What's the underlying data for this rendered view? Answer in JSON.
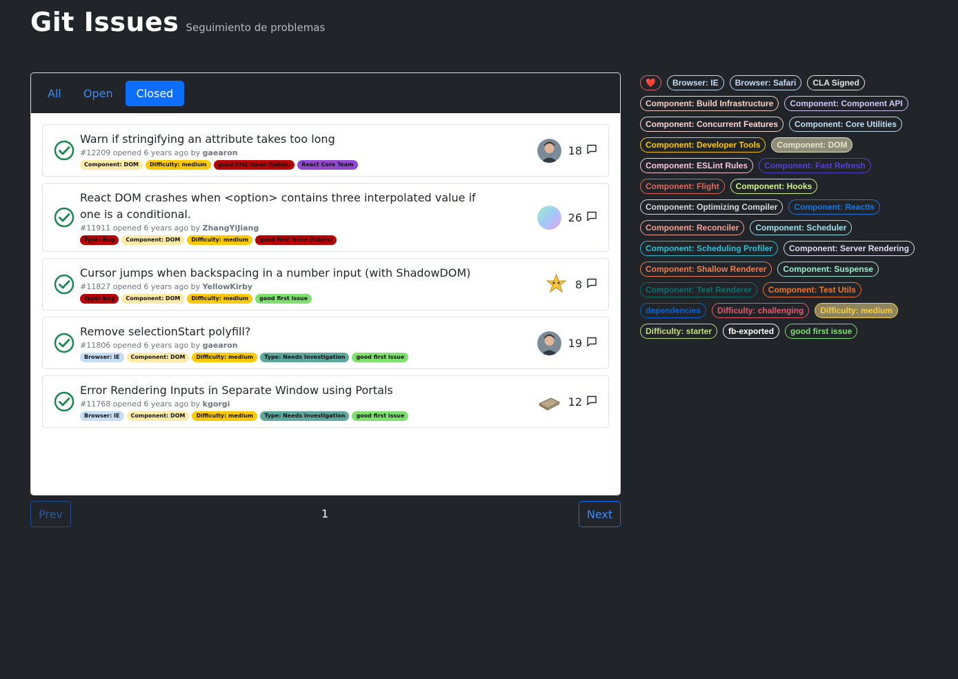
{
  "header": {
    "title": "Git Issues",
    "subtitle": "Seguimiento de problemas"
  },
  "tabs": [
    {
      "label": "All",
      "active": false
    },
    {
      "label": "Open",
      "active": false
    },
    {
      "label": "Closed",
      "active": true
    }
  ],
  "issues": [
    {
      "title": "Warn if stringifying an attribute takes too long",
      "number": "#12209",
      "opened": "opened 6 years ago by",
      "author": "gaearon",
      "comments": "18",
      "avatar": "person-avatar",
      "labels": [
        {
          "text": "Component: DOM",
          "bg": "#fbeaa8",
          "fg": "#111111"
        },
        {
          "text": "Difficulty: medium",
          "bg": "#fbca04",
          "fg": "#111111"
        },
        {
          "text": "good first issue (taken)",
          "bg": "#b60205",
          "fg": "#111111"
        },
        {
          "text": "React Core Team",
          "bg": "#9149d1",
          "fg": "#111111"
        }
      ]
    },
    {
      "title": "React DOM crashes when <option> contains three interpolated value if one is a conditional.",
      "number": "#11911",
      "opened": "opened 6 years ago by",
      "author": "ZhangYiJiang",
      "comments": "26",
      "avatar": "gradient-avatar",
      "labels": [
        {
          "text": "Type: Bug",
          "bg": "#b60205",
          "fg": "#111111"
        },
        {
          "text": "Component: DOM",
          "bg": "#fbeaa8",
          "fg": "#111111"
        },
        {
          "text": "Difficulty: medium",
          "bg": "#fbca04",
          "fg": "#111111"
        },
        {
          "text": "good first issue (taken)",
          "bg": "#b60205",
          "fg": "#111111"
        }
      ]
    },
    {
      "title": "Cursor jumps when backspacing in a number input (with ShadowDOM)",
      "number": "#11827",
      "opened": "opened 6 years ago by",
      "author": "YellowKirby",
      "comments": "8",
      "avatar": "star-avatar",
      "labels": [
        {
          "text": "Type: Bug",
          "bg": "#b60205",
          "fg": "#111111"
        },
        {
          "text": "Component: DOM",
          "bg": "#fbeaa8",
          "fg": "#111111"
        },
        {
          "text": "Difficulty: medium",
          "bg": "#fbca04",
          "fg": "#111111"
        },
        {
          "text": "good first issue",
          "bg": "#7ee06d",
          "fg": "#111111"
        }
      ]
    },
    {
      "title": "Remove selectionStart polyfill?",
      "number": "#11806",
      "opened": "opened 6 years ago by",
      "author": "gaearon",
      "comments": "19",
      "avatar": "person-avatar",
      "labels": [
        {
          "text": "Browser: IE",
          "bg": "#c5def5",
          "fg": "#111111"
        },
        {
          "text": "Component: DOM",
          "bg": "#fbeaa8",
          "fg": "#111111"
        },
        {
          "text": "Difficulty: medium",
          "bg": "#fbca04",
          "fg": "#111111"
        },
        {
          "text": "Type: Needs Investigation",
          "bg": "#5fa8a0",
          "fg": "#111111"
        },
        {
          "text": "good first issue",
          "bg": "#7ee06d",
          "fg": "#111111"
        }
      ]
    },
    {
      "title": "Error Rendering Inputs in Separate Window using Portals",
      "number": "#11768",
      "opened": "opened 6 years ago by",
      "author": "kgorgi",
      "comments": "12",
      "avatar": "computer-avatar",
      "labels": [
        {
          "text": "Browser: IE",
          "bg": "#c5def5",
          "fg": "#111111"
        },
        {
          "text": "Component: DOM",
          "bg": "#fbeaa8",
          "fg": "#111111"
        },
        {
          "text": "Difficulty: medium",
          "bg": "#fbca04",
          "fg": "#111111"
        },
        {
          "text": "Type: Needs Investigation",
          "bg": "#5fa8a0",
          "fg": "#111111"
        },
        {
          "text": "good first issue",
          "bg": "#7ee06d",
          "fg": "#111111"
        }
      ]
    }
  ],
  "pagination": {
    "prev": "Prev",
    "page": "1",
    "next": "Next"
  },
  "sidebar_tags": [
    {
      "text": "❤️",
      "color": "#e06c75",
      "bg": ""
    },
    {
      "text": "Browser: IE",
      "color": "#c5def5",
      "bg": ""
    },
    {
      "text": "Browser: Safari",
      "color": "#c5def5",
      "bg": ""
    },
    {
      "text": "CLA Signed",
      "color": "#e6e6e6",
      "bg": ""
    },
    {
      "text": "Component: Build Infrastructure",
      "color": "#f9d0c4",
      "bg": ""
    },
    {
      "text": "Component: Component API",
      "color": "#d4c5f9",
      "bg": ""
    },
    {
      "text": "Component: Concurrent Features",
      "color": "#fbd4d4",
      "bg": ""
    },
    {
      "text": "Component: Core Utilities",
      "color": "#c2e0f0",
      "bg": ""
    },
    {
      "text": "Component: Developer Tools",
      "color": "#fbca04",
      "bg": ""
    },
    {
      "text": "Component: DOM",
      "color": "#e8e6c8",
      "bg": "#8f8c7a"
    },
    {
      "text": "Component: ESLint Rules",
      "color": "#f9c6d8",
      "bg": ""
    },
    {
      "text": "Component: Fast Refresh",
      "color": "#5b3fd1",
      "bg": ""
    },
    {
      "text": "Component: Flight",
      "color": "#e0695a",
      "bg": ""
    },
    {
      "text": "Component: Hooks",
      "color": "#d4f58a",
      "bg": ""
    },
    {
      "text": "Component: Optimizing Compiler",
      "color": "#dcdcdc",
      "bg": ""
    },
    {
      "text": "Component: ReactIs",
      "color": "#1d76db",
      "bg": ""
    },
    {
      "text": "Component: Reconciler",
      "color": "#f4a59b",
      "bg": ""
    },
    {
      "text": "Component: Scheduler",
      "color": "#a6e3f0",
      "bg": ""
    },
    {
      "text": "Component: Scheduling Profiler",
      "color": "#2bc0d6",
      "bg": ""
    },
    {
      "text": "Component: Server Rendering",
      "color": "#e4dcf5",
      "bg": ""
    },
    {
      "text": "Component: Shallow Renderer",
      "color": "#f08050",
      "bg": ""
    },
    {
      "text": "Component: Suspense",
      "color": "#a0f0d0",
      "bg": ""
    },
    {
      "text": "Component: Test Renderer",
      "color": "#0e6f6f",
      "bg": ""
    },
    {
      "text": "Component: Test Utils",
      "color": "#f0782c",
      "bg": ""
    },
    {
      "text": "dependencies",
      "color": "#0366d6",
      "bg": ""
    },
    {
      "text": "Difficulty: challenging",
      "color": "#e65a6e",
      "bg": ""
    },
    {
      "text": "Difficulty: medium",
      "color": "#f9d03c",
      "bg": "#8f8460"
    },
    {
      "text": "Difficulty: starter",
      "color": "#c2e07a",
      "bg": ""
    },
    {
      "text": "fb-exported",
      "color": "#ffffff",
      "bg": ""
    },
    {
      "text": "good first issue",
      "color": "#7ee06d",
      "bg": ""
    }
  ]
}
